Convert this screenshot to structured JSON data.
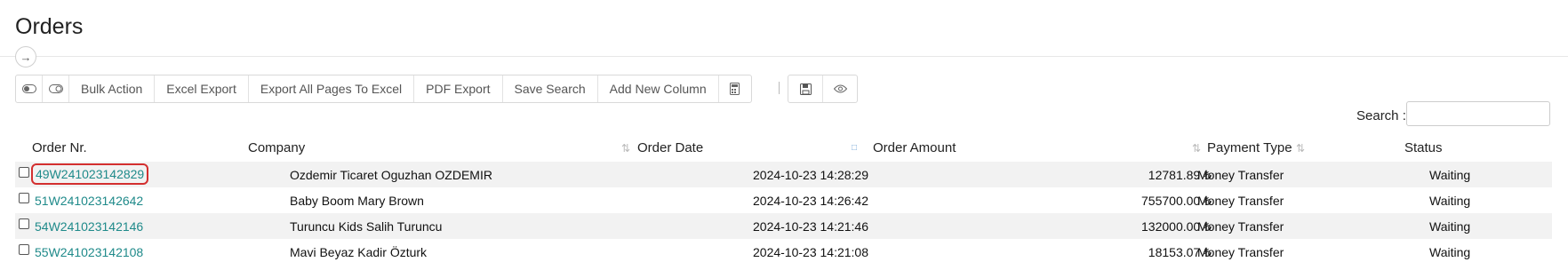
{
  "page": {
    "title": "Orders"
  },
  "toolbar": {
    "bulk_action": "Bulk Action",
    "excel_export": "Excel Export",
    "export_all": "Export All Pages To Excel",
    "pdf_export": "PDF Export",
    "save_search": "Save Search",
    "add_column": "Add New Column"
  },
  "search": {
    "label": "Search :",
    "value": ""
  },
  "columns": {
    "order_nr": "Order Nr.",
    "company": "Company",
    "order_date": "Order Date",
    "order_amount": "Order Amount",
    "payment_type": "Payment Type",
    "status": "Status"
  },
  "rows": [
    {
      "order_nr": "49W241023142829",
      "company": "Ozdemir Ticaret Oguzhan OZDEMIR",
      "order_date": "2024-10-23 14:28:29",
      "amount": "12781.89 ₺",
      "payment": "Money Transfer",
      "status": "Waiting"
    },
    {
      "order_nr": "51W241023142642",
      "company": "Baby Boom Mary Brown",
      "order_date": "2024-10-23 14:26:42",
      "amount": "755700.00 ₺",
      "payment": "Money Transfer",
      "status": "Waiting"
    },
    {
      "order_nr": "54W241023142146",
      "company": "Turuncu Kids Salih Turuncu",
      "order_date": "2024-10-23 14:21:46",
      "amount": "132000.00 ₺",
      "payment": "Money Transfer",
      "status": "Waiting"
    },
    {
      "order_nr": "55W241023142108",
      "company": "Mavi Beyaz Kadir Özturk",
      "order_date": "2024-10-23 14:21:08",
      "amount": "18153.07 ₺",
      "payment": "Money Transfer",
      "status": "Waiting"
    }
  ]
}
